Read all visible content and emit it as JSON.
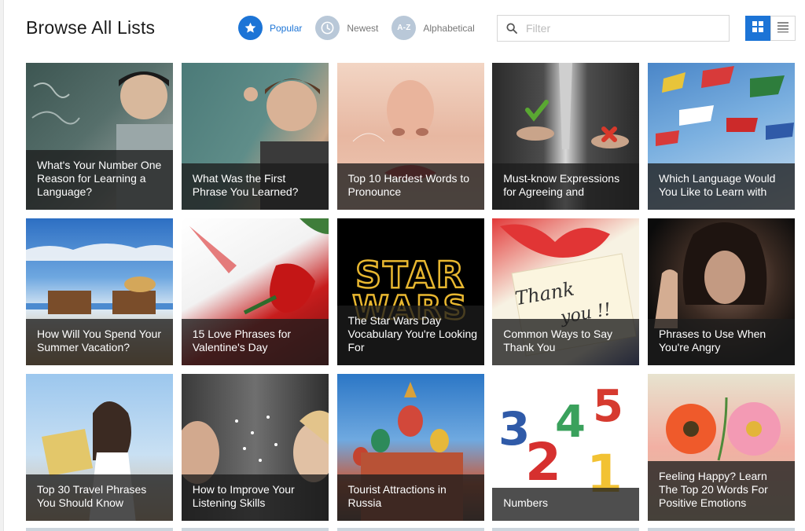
{
  "header": {
    "title": "Browse All Lists",
    "sort_options": [
      {
        "label": "Popular",
        "icon": "star-icon",
        "active": true
      },
      {
        "label": "Newest",
        "icon": "clock-icon",
        "active": false
      },
      {
        "label": "Alphabetical",
        "icon": "az-icon",
        "badge": "A-Z",
        "active": false
      }
    ],
    "filter": {
      "placeholder": "Filter",
      "value": ""
    },
    "view_modes": [
      {
        "name": "grid",
        "icon": "grid-view-icon",
        "active": true
      },
      {
        "name": "list",
        "icon": "list-view-icon",
        "active": false
      }
    ]
  },
  "colors": {
    "accent": "#1c74d6",
    "inactive_icon": "#b9c8d8",
    "caption_overlay": "rgba(28,28,28,0.78)"
  },
  "cards": [
    {
      "title": "What's Your Number One Reason for Learning a Language?",
      "image": "chalkboard-photo"
    },
    {
      "title": "What Was the First Phrase You Learned?",
      "image": "teacher-photo"
    },
    {
      "title": "Top 10 Hardest Words to Pronounce",
      "image": "lips-photo"
    },
    {
      "title": "Must-know Expressions for Agreeing and",
      "image": "suit-photo"
    },
    {
      "title": "Which Language Would You Like to Learn with",
      "image": "flags-photo"
    },
    {
      "title": "How Will You Spend Your Summer Vacation?",
      "image": "beach-photo"
    },
    {
      "title": "15 Love Phrases for Valentine's Day",
      "image": "rose-photo"
    },
    {
      "title": "The Star Wars Day Vocabulary You're Looking For",
      "image": "star-wars-logo",
      "logo_text": [
        "STAR",
        "WARS"
      ]
    },
    {
      "title": "Common Ways to Say Thank You",
      "image": "thank-you-card-photo",
      "note_text": [
        "Thank",
        "you !!"
      ]
    },
    {
      "title": "Phrases to Use When You're Angry",
      "image": "angry-woman-photo"
    },
    {
      "title": "Top 30 Travel Phrases You Should Know",
      "image": "traveler-photo"
    },
    {
      "title": "How to Improve Your Listening Skills",
      "image": "listening-photo"
    },
    {
      "title": "Tourist Attractions in Russia",
      "image": "st-basils-photo"
    },
    {
      "title": "Numbers",
      "image": "numbers-photo",
      "digits": [
        "3",
        "4",
        "5",
        "2",
        "1"
      ]
    },
    {
      "title": "Feeling Happy? Learn The Top 20 Words For Positive Emotions",
      "image": "flowers-photo"
    }
  ]
}
